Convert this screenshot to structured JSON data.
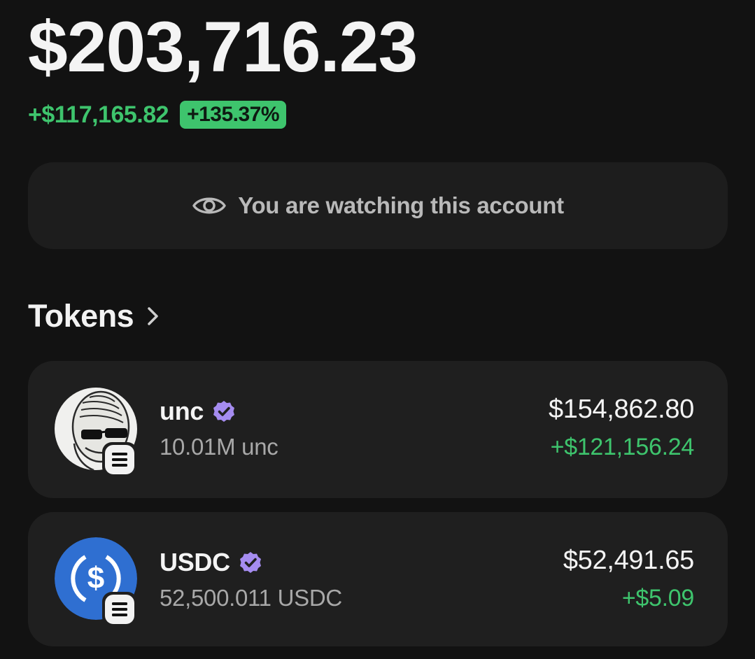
{
  "portfolio": {
    "balance": "$203,716.23",
    "change_amount": "+$117,165.82",
    "change_percent": "+135.37%"
  },
  "watch_banner": {
    "icon": "eye-icon",
    "text": "You are watching this account"
  },
  "tokens_section": {
    "title": "Tokens",
    "chevron_icon": "chevron-right-icon"
  },
  "tokens": [
    {
      "name": "unc",
      "verified": true,
      "quantity": "10.01M unc",
      "value": "$154,862.80",
      "change": "+$121,156.24",
      "logo_icon": "unc-avatar",
      "chain_icon": "solana-icon"
    },
    {
      "name": "USDC",
      "verified": true,
      "quantity": "52,500.011 USDC",
      "value": "$52,491.65",
      "change": "+$5.09",
      "logo_icon": "usdc-logo",
      "chain_icon": "solana-icon"
    }
  ],
  "colors": {
    "background": "#121212",
    "card": "#1f1f1f",
    "positive": "#3ec46d",
    "verified": "#a58cf0",
    "usdc_blue": "#2f6fd1"
  }
}
